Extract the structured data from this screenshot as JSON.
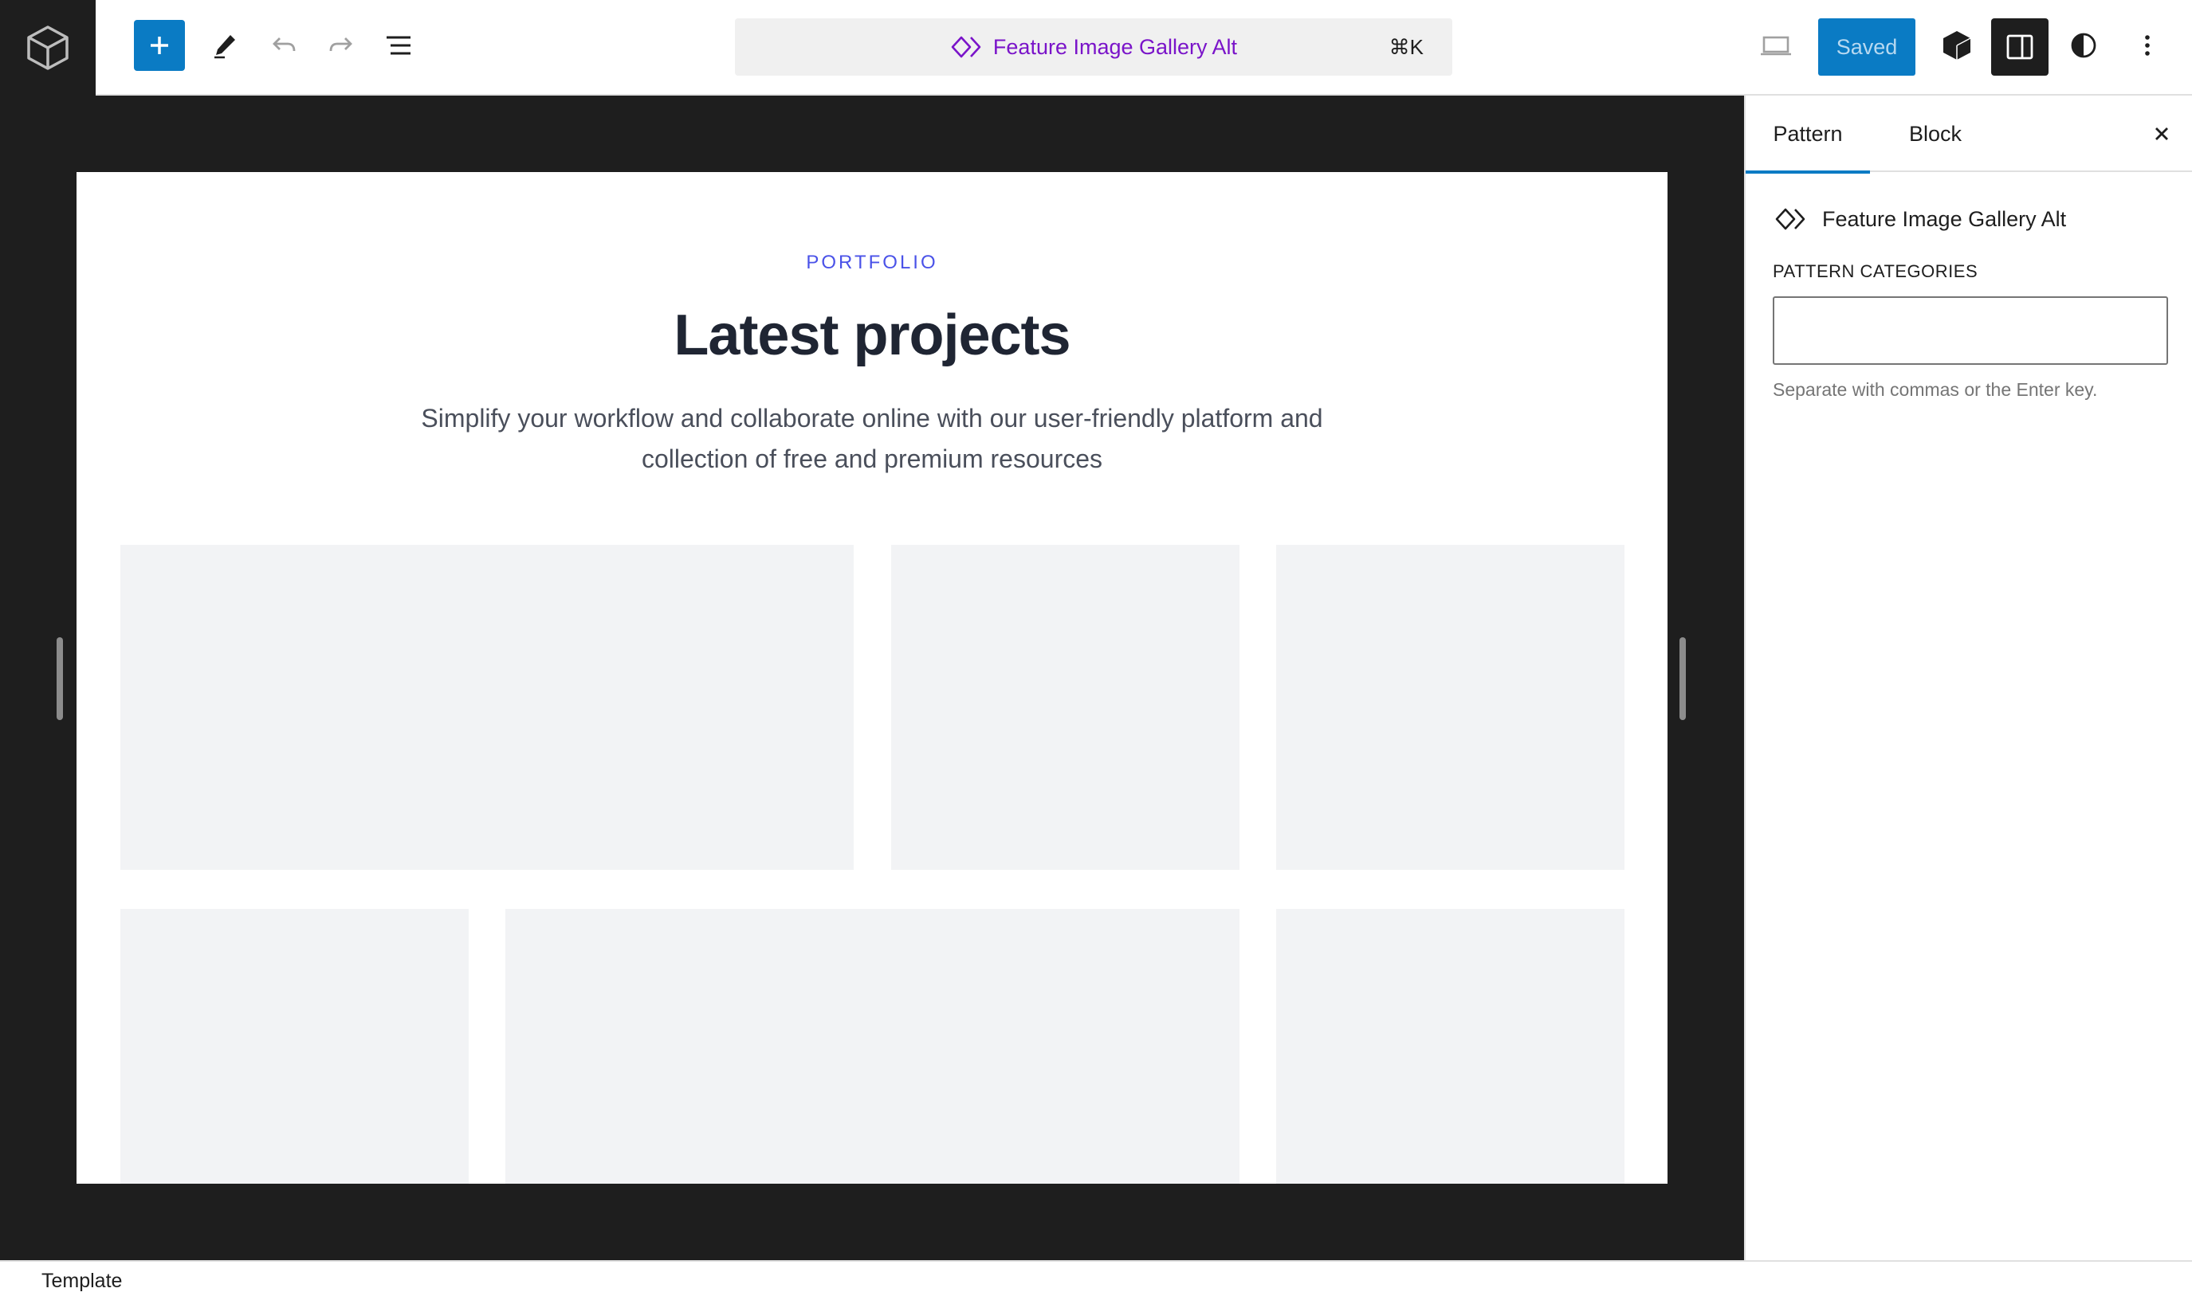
{
  "toolbar": {
    "add_block_icon": "plus-icon",
    "tools_icon": "pencil-icon",
    "undo_icon": "undo-icon",
    "redo_icon": "redo-icon",
    "list_view_icon": "list-view-icon",
    "command": {
      "title": "Feature Image Gallery Alt",
      "shortcut": "⌘K",
      "icon": "pattern-diamond-icon",
      "color": "#7a14c9"
    },
    "preview_icon": "laptop-icon",
    "save_label": "Saved",
    "accent_color": "#0a7bc4"
  },
  "canvas": {
    "eyebrow": "PORTFOLIO",
    "heading": "Latest projects",
    "intro": "Simplify your workflow and collaborate online with our user-friendly platform and collection of free and premium resources",
    "gallery_count": 6
  },
  "sidebar": {
    "tabs": [
      {
        "label": "Pattern",
        "active": true
      },
      {
        "label": "Block",
        "active": false
      }
    ],
    "pattern_name": "Feature Image Gallery Alt",
    "categories_label": "PATTERN CATEGORIES",
    "categories_value": "",
    "categories_help": "Separate with commas or the Enter key."
  },
  "footer": {
    "breadcrumb": "Template"
  }
}
